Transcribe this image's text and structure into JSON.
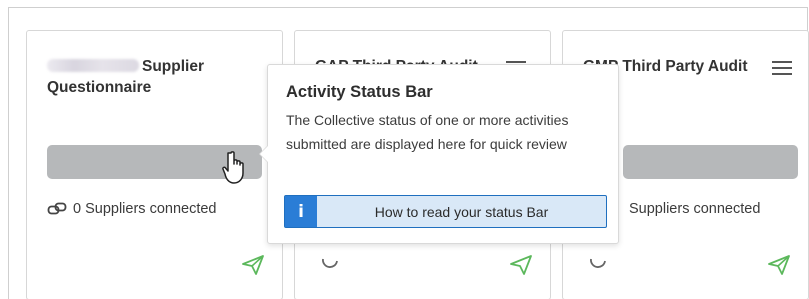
{
  "cards": [
    {
      "title_suffix": "Supplier Questionnaire",
      "connected_text": "0 Suppliers connected"
    },
    {
      "title": "GAP Third Party Audit"
    },
    {
      "title": "GMP Third Party Audit",
      "connected_text": "Suppliers connected"
    }
  ],
  "tooltip": {
    "title": "Activity Status Bar",
    "body": "The Collective status of one or more activities submitted are displayed here for quick review",
    "button_icon": "i",
    "button_label": "How to read your status Bar"
  },
  "icons": {
    "menu": "hamburger-menu-icon",
    "link": "link-icon",
    "send": "send-icon",
    "refresh": "refresh-icon",
    "cursor": "hand-pointer-icon",
    "info": "info-icon"
  },
  "colors": {
    "status_bar": "#b6b8ba",
    "send_icon": "#5cb85c",
    "info_blue": "#2a7dd6",
    "button_bg": "#d9e8f7"
  }
}
